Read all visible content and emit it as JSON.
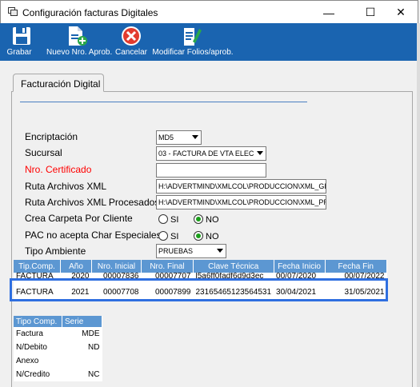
{
  "window": {
    "title": "Configuración facturas Digitales",
    "minimize": "—",
    "maximize": "☐",
    "close": "✕"
  },
  "toolbar": {
    "buttons": [
      {
        "label": "Grabar",
        "icon": "save-icon"
      },
      {
        "label": "Nuevo Nro. Aprob.",
        "icon": "new-document-icon"
      },
      {
        "label": "Cancelar",
        "icon": "cancel-icon"
      },
      {
        "label": "Modificar Folios/aprob.",
        "icon": "edit-document-icon"
      }
    ],
    "color": "#1a64b0"
  },
  "tab": {
    "label": "Facturación Digital"
  },
  "form": {
    "encriptacion": {
      "label": "Encriptación",
      "value": "MD5"
    },
    "sucursal": {
      "label": "Sucursal",
      "value": "03 - FACTURA DE VTA ELEC"
    },
    "nro_certificado": {
      "label": "Nro. Certificado",
      "value": ""
    },
    "ruta_xml": {
      "label": "Ruta Archivos XML",
      "value": "H:\\ADVERTMIND\\XMLCOL\\PRODUCCION\\XML_GEN"
    },
    "ruta_xml_procesados": {
      "label": "Ruta Archivos XML Procesados",
      "value": "H:\\ADVERTMIND\\XMLCOL\\PRODUCCION\\XML_PRO"
    },
    "crea_carpeta": {
      "label": "Crea Carpeta Por Cliente",
      "options": [
        "SI",
        "NO"
      ],
      "selected": "NO"
    },
    "pac_char": {
      "label": "PAC no acepta Char Especiales",
      "options": [
        "SI",
        "NO"
      ],
      "selected": "NO"
    },
    "tipo_ambiente": {
      "label": "Tipo Ambiente",
      "value": "PRUEBAS"
    }
  },
  "grid_aprobaciones": {
    "headers": [
      "Tip.Comp.",
      "Año",
      "Nro. Inicial",
      "Nro. Final",
      "Clave Técnica",
      "Fecha Inicio",
      "Fecha Fin"
    ],
    "rows": [
      [
        "FACTURA",
        "2020",
        "00007836",
        "00007707",
        "l5a6ff0fadf6d9d3ec",
        "00/07/2020",
        "00/07/2022"
      ],
      [
        "FACTURA",
        "2021",
        "00007708",
        "00007899",
        "23165465123564531",
        "30/04/2021",
        "31/05/2021"
      ]
    ],
    "header_color": "#5c97d2",
    "highlight_color": "#2f6fe0"
  },
  "grid_series": {
    "headers": [
      "Tipo Comp.",
      "Serie"
    ],
    "rows": [
      [
        "Factura",
        "MDE"
      ],
      [
        "N/Debito",
        "ND"
      ],
      [
        "Anexo",
        ""
      ],
      [
        "N/Credito",
        "NC"
      ]
    ]
  }
}
